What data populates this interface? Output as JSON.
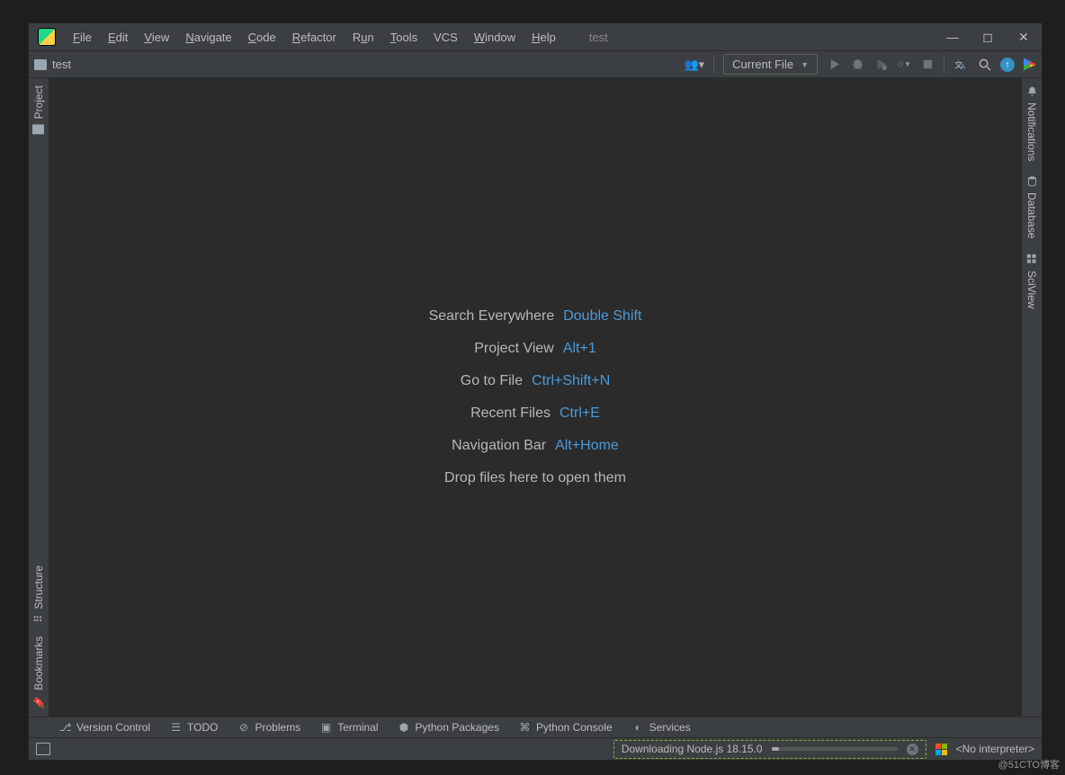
{
  "menu": {
    "file": "File",
    "edit": "Edit",
    "view": "View",
    "navigate": "Navigate",
    "code": "Code",
    "refactor": "Refactor",
    "run": "Run",
    "tools": "Tools",
    "vcs": "VCS",
    "window": "Window",
    "help": "Help"
  },
  "project_name": "test",
  "breadcrumb": {
    "project": "test"
  },
  "run_config": {
    "label": "Current File"
  },
  "left_stripe": {
    "project": "Project",
    "structure": "Structure",
    "bookmarks": "Bookmarks"
  },
  "right_stripe": {
    "notifications": "Notifications",
    "database": "Database",
    "sciview": "SciView"
  },
  "tips": [
    {
      "label": "Search Everywhere",
      "shortcut": "Double Shift"
    },
    {
      "label": "Project View",
      "shortcut": "Alt+1"
    },
    {
      "label": "Go to File",
      "shortcut": "Ctrl+Shift+N"
    },
    {
      "label": "Recent Files",
      "shortcut": "Ctrl+E"
    },
    {
      "label": "Navigation Bar",
      "shortcut": "Alt+Home"
    }
  ],
  "drop_hint": "Drop files here to open them",
  "bottom_tabs": {
    "vcs": "Version Control",
    "todo": "TODO",
    "problems": "Problems",
    "terminal": "Terminal",
    "pypkg": "Python Packages",
    "pyconsole": "Python Console",
    "services": "Services"
  },
  "status": {
    "download": "Downloading Node.js 18.15.0",
    "interpreter": "<No interpreter>"
  },
  "watermark": "@51CTO博客"
}
